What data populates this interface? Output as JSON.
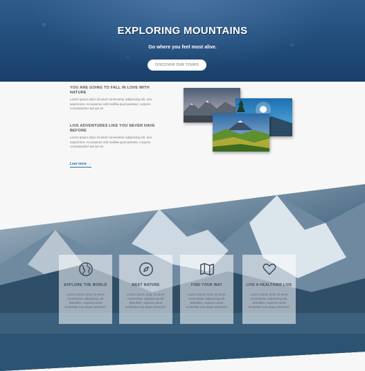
{
  "hero": {
    "title": "EXPLORING MOUNTAINS",
    "subtitle": "Go where you feel most alive.",
    "button_label": "DISCOVER OUR TOURS"
  },
  "intro": {
    "heading_1": "YOU ARE GOING TO FALL IN LOVE WITH NATURE",
    "text_1": "Lorem ipsum dolor sit amet consectetur adipisicing elit. Iure, asperiores. Accusamus odit mollitia quod pariatur, corporis consequuntur aut qui sit.",
    "heading_2": "LIVE ADVENTURES LIKE YOU NEVER HAVE BEFORE",
    "text_2": "Lorem ipsum dolor sit amet consectetur adipisicing elit. Iure, asperiores. Accusamus odit mollitia quod pariatur, corporis consequuntur aut qui sit.",
    "link_label": "Lear more →"
  },
  "features": [
    {
      "icon": "globe-icon",
      "title": "EXPLORE THE WORLD",
      "text": "Lorem ipsum dolor sit amet consectetur adipisicing elit. Blanditiis, asperes amet molestiae eos atque dicarturi?"
    },
    {
      "icon": "compass-icon",
      "title": "MEET NATURE",
      "text": "Lorem ipsum dolor sit amet consectetur adipisicing elit. Blanditiis, asperes amet molestiae eos atque dicarturi?"
    },
    {
      "icon": "map-icon",
      "title": "FIND YOUR WAY",
      "text": "Lorem ipsum dolor sit amet consectetur adipisicing elit. Blanditiis, asperes amet molestiae eos atque dicarturi?"
    },
    {
      "icon": "heart-icon",
      "title": "LIVE A HEALTHIER LIVE",
      "text": "Lorem ipsum dolor sit amet consectetur adipisicing elit. Blanditiis, asperes amet molestiae eos atque dicarturi?"
    }
  ],
  "colors": {
    "accent": "#1d6fae",
    "hero": "#23507f",
    "icon": "#3a4a5a"
  }
}
